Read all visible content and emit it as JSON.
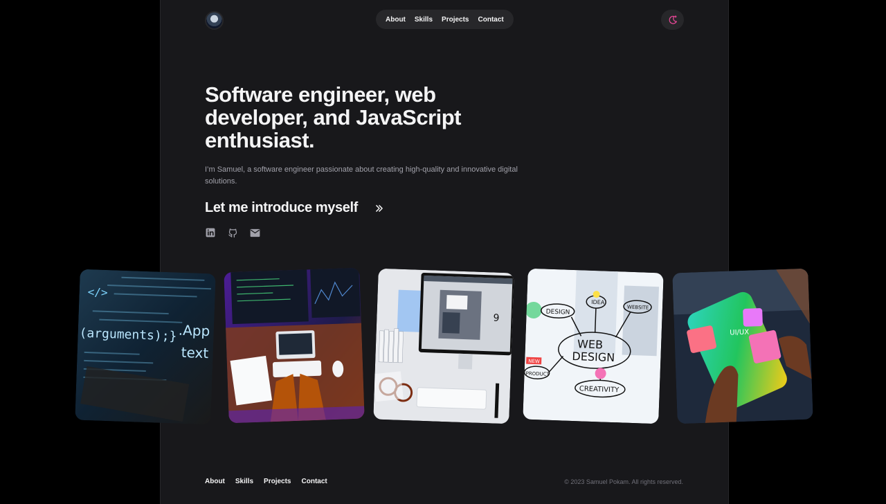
{
  "nav": {
    "items": [
      "About",
      "Skills",
      "Projects",
      "Contact"
    ]
  },
  "hero": {
    "headline": "Software engineer, web developer, and JavaScript enthusiast.",
    "intro_text": "I’m Samuel, a software engineer passionate about creating high-quality and innovative digital solutions.",
    "cta_label": "Let me introduce myself"
  },
  "socials": [
    "linkedin-icon",
    "github-icon",
    "mail-icon"
  ],
  "gallery": {
    "photos": [
      {
        "overlay_text": [
          "</>",
          "(arguments);}",
          ".App",
          "text"
        ]
      },
      {},
      {
        "overlay_text": [
          "9"
        ]
      },
      {
        "overlay_text": [
          "DESIGN",
          "IDEA",
          "WEBSITE",
          "WEB",
          "DESIGN",
          "CREATIVITY",
          "PRODUCT",
          "NEW"
        ]
      },
      {
        "overlay_text": [
          "UI/UX"
        ]
      }
    ]
  },
  "footer": {
    "items": [
      "About",
      "Skills",
      "Projects",
      "Contact"
    ],
    "copyright": "© 2023 Samuel Pokam. All rights reserved."
  },
  "colors": {
    "background": "#000000",
    "panel": "#18181b",
    "nav_pill": "#27272a",
    "text": "#f4f4f5",
    "muted": "#a1a1aa",
    "accent": "#ec4899"
  }
}
